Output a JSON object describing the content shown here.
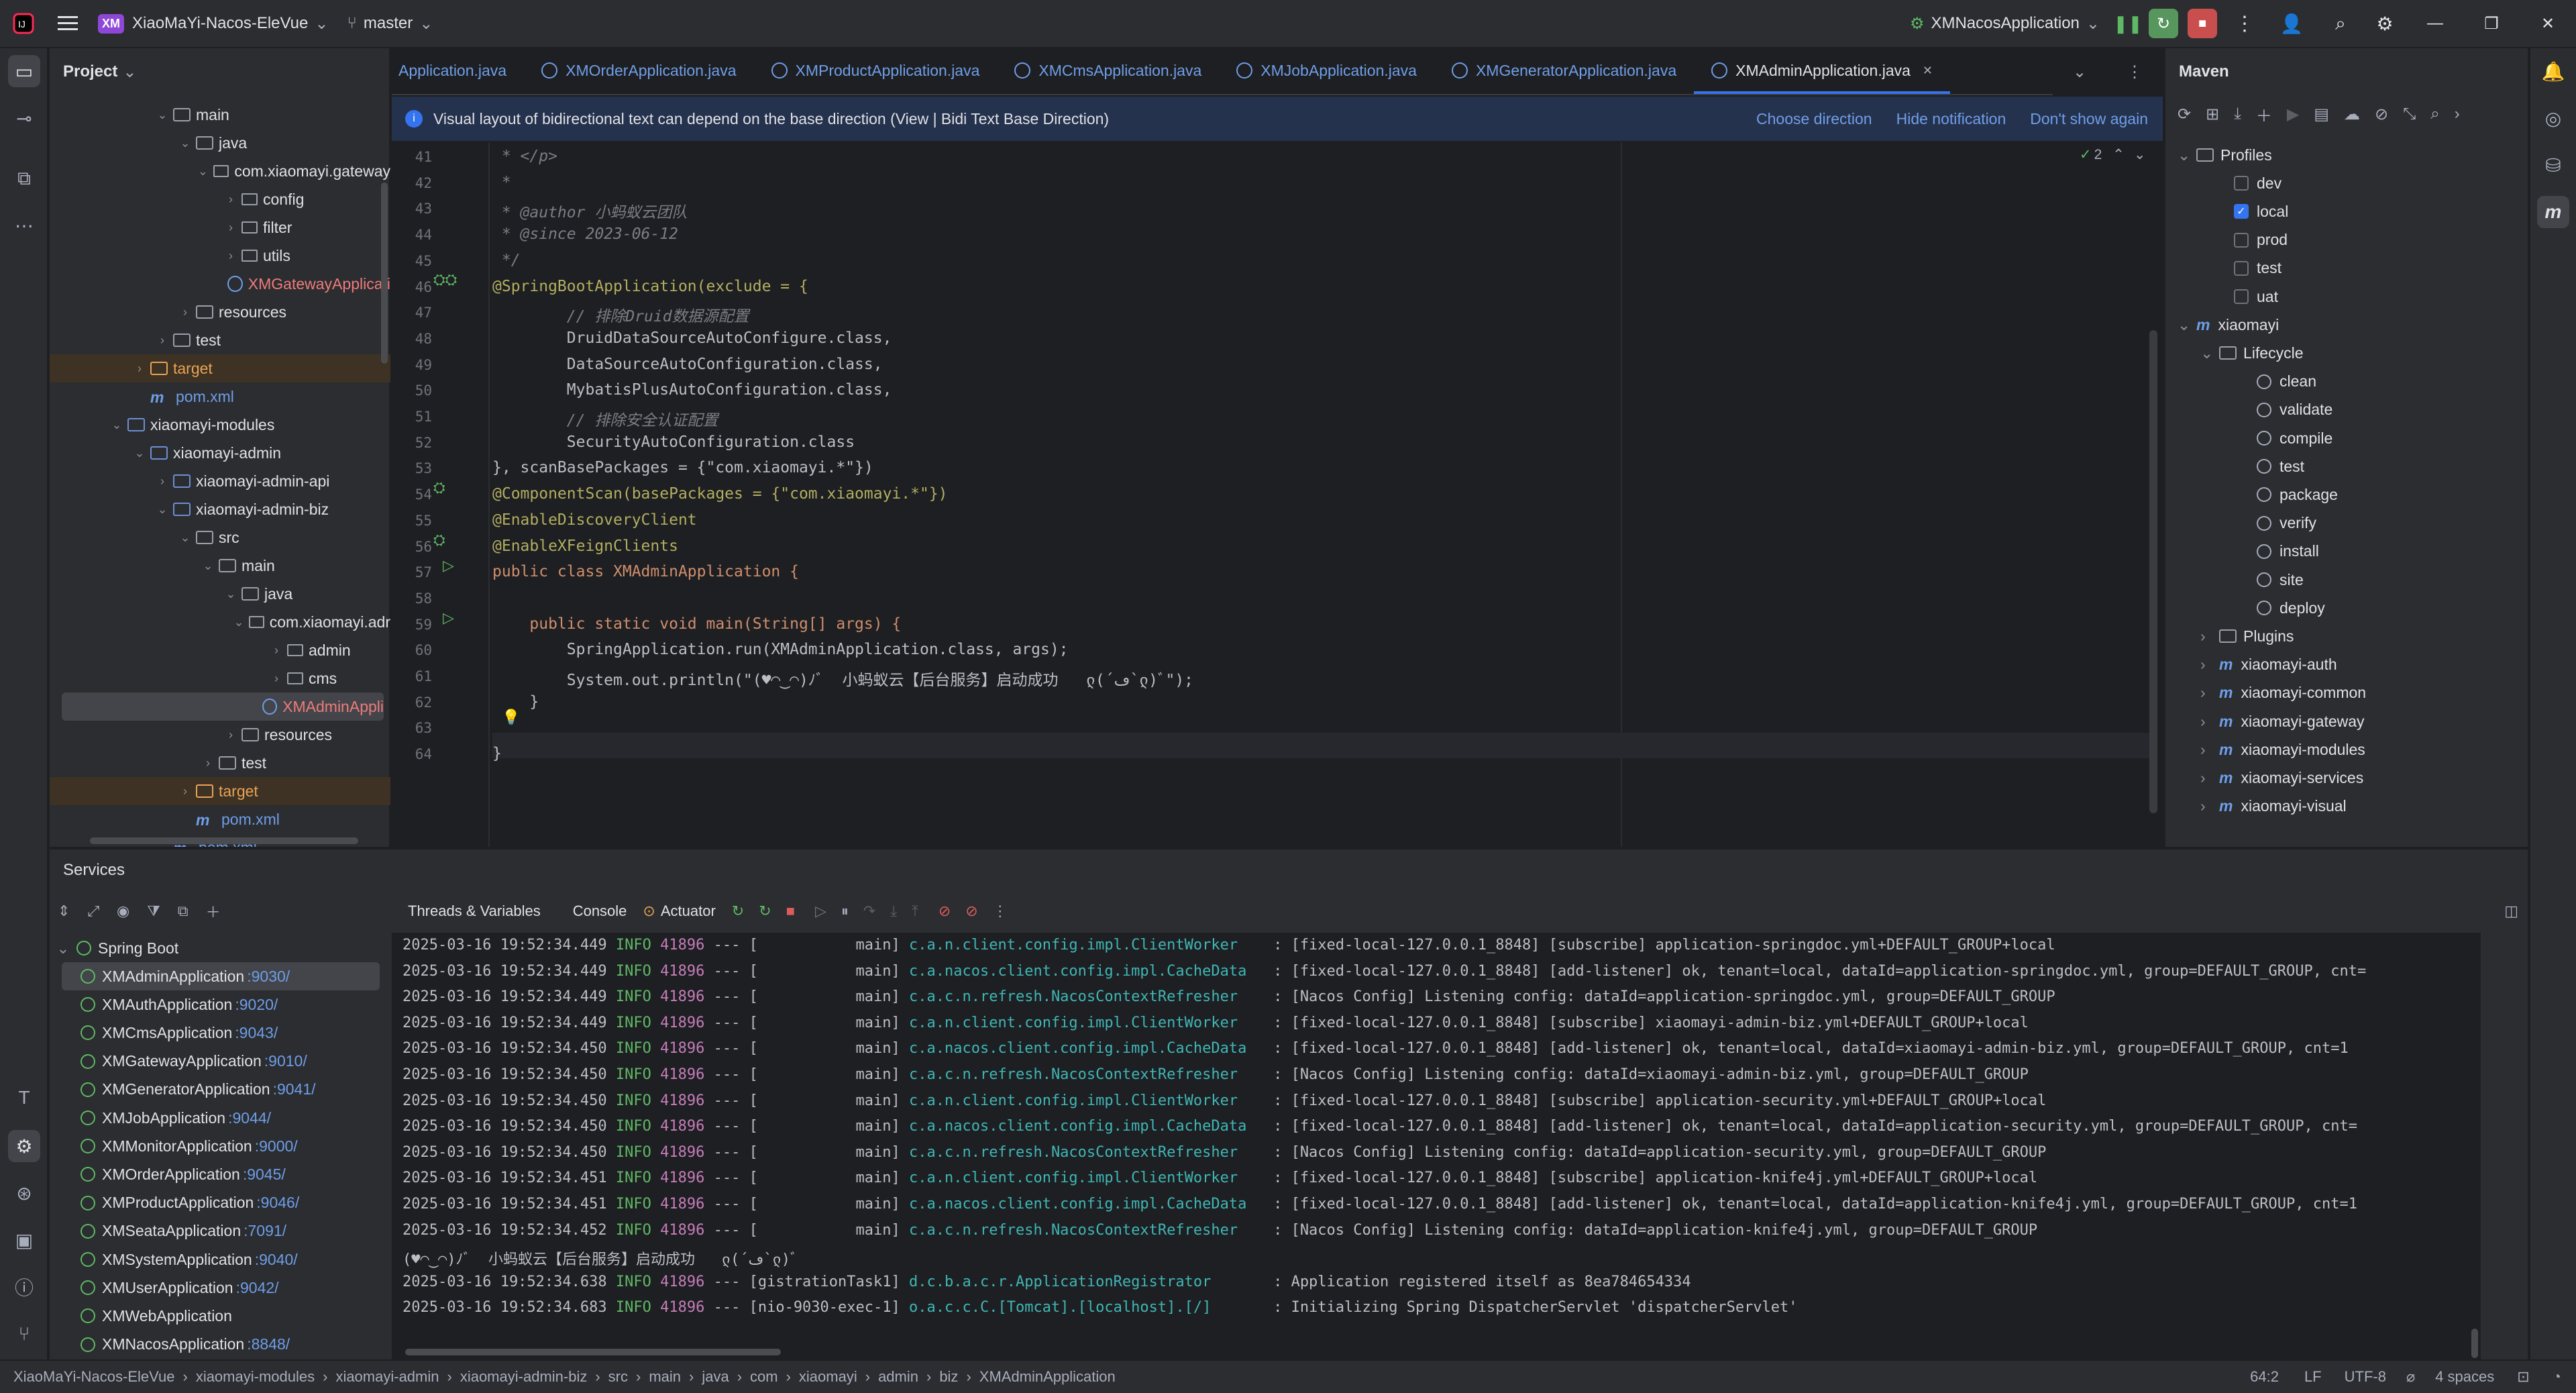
{
  "titlebar": {
    "project_badge": "XM",
    "project": "XiaoMaYi-Nacos-EleVue",
    "branch": "master",
    "run_config": "XMNacosApplication"
  },
  "project_panel": {
    "title": "Project",
    "items": [
      {
        "label": "main",
        "depth": 4,
        "icon": "folder",
        "arrow": "v"
      },
      {
        "label": "java",
        "depth": 5,
        "icon": "folder",
        "arrow": "v"
      },
      {
        "label": "com.xiaomayi.gateway",
        "depth": 6,
        "icon": "package",
        "arrow": "v"
      },
      {
        "label": "config",
        "depth": 7,
        "icon": "package",
        "arrow": ">"
      },
      {
        "label": "filter",
        "depth": 7,
        "icon": "package",
        "arrow": ">"
      },
      {
        "label": "utils",
        "depth": 7,
        "icon": "package",
        "arrow": ">"
      },
      {
        "label": "XMGatewayApplicati",
        "depth": 7,
        "icon": "class",
        "arrow": "",
        "color": "red"
      },
      {
        "label": "resources",
        "depth": 5,
        "icon": "folder",
        "arrow": ">"
      },
      {
        "label": "test",
        "depth": 4,
        "icon": "folder",
        "arrow": ">"
      },
      {
        "label": "target",
        "depth": 3,
        "icon": "folder",
        "arrow": ">",
        "excluded": true
      },
      {
        "label": "pom.xml",
        "depth": 3,
        "icon": "maven",
        "arrow": "",
        "color": "blue"
      },
      {
        "label": "xiaomayi-modules",
        "depth": 2,
        "icon": "module",
        "arrow": "v"
      },
      {
        "label": "xiaomayi-admin",
        "depth": 3,
        "icon": "module",
        "arrow": "v"
      },
      {
        "label": "xiaomayi-admin-api",
        "depth": 4,
        "icon": "module",
        "arrow": ">"
      },
      {
        "label": "xiaomayi-admin-biz",
        "depth": 4,
        "icon": "module",
        "arrow": "v"
      },
      {
        "label": "src",
        "depth": 5,
        "icon": "folder",
        "arrow": "v"
      },
      {
        "label": "main",
        "depth": 6,
        "icon": "folder",
        "arrow": "v"
      },
      {
        "label": "java",
        "depth": 7,
        "icon": "folder",
        "arrow": "v"
      },
      {
        "label": "com.xiaomayi.adr",
        "depth": 8,
        "icon": "package",
        "arrow": "v"
      },
      {
        "label": "admin",
        "depth": 9,
        "icon": "package",
        "arrow": ">"
      },
      {
        "label": "cms",
        "depth": 9,
        "icon": "package",
        "arrow": ">"
      },
      {
        "label": "XMAdminAppli",
        "depth": 9,
        "icon": "class",
        "arrow": "",
        "color": "red",
        "selected": true
      },
      {
        "label": "resources",
        "depth": 7,
        "icon": "folder",
        "arrow": ">"
      },
      {
        "label": "test",
        "depth": 6,
        "icon": "folder",
        "arrow": ">"
      },
      {
        "label": "target",
        "depth": 5,
        "icon": "folder",
        "arrow": ">",
        "excluded": true
      },
      {
        "label": "pom.xml",
        "depth": 5,
        "icon": "maven",
        "arrow": "",
        "color": "blue"
      },
      {
        "label": "pom.xml",
        "depth": 4,
        "icon": "maven",
        "arrow": "",
        "color": "blue"
      }
    ]
  },
  "editor": {
    "tabs": [
      "Application.java",
      "XMOrderApplication.java",
      "XMProductApplication.java",
      "XMCmsApplication.java",
      "XMJobApplication.java",
      "XMGeneratorApplication.java",
      "XMAdminApplication.java"
    ],
    "active_tab": "XMAdminApplication.java",
    "notification": {
      "text": "Visual layout of bidirectional text can depend on the base direction (View | Bidi Text Base Direction)",
      "actions": [
        "Choose direction",
        "Hide notification",
        "Don't show again"
      ]
    },
    "inspection_count": "2",
    "line_numbers": [
      "41",
      "42",
      "43",
      "44",
      "45",
      "46",
      "47",
      "48",
      "49",
      "50",
      "51",
      "52",
      "53",
      "54",
      "55",
      "56",
      "57",
      "58",
      "59",
      "60",
      "61",
      "62",
      "63",
      "64"
    ],
    "code_lines": [
      " * </p>",
      " *",
      " * @author 小蚂蚁云团队",
      " * @since 2023-06-12",
      " */",
      "@SpringBootApplication(exclude = {",
      "        // 排除Druid数据源配置",
      "        DruidDataSourceAutoConfigure.class,",
      "        DataSourceAutoConfiguration.class,",
      "        MybatisPlusAutoConfiguration.class,",
      "        // 排除安全认证配置",
      "        SecurityAutoConfiguration.class",
      "}, scanBasePackages = {\"com.xiaomayi.*\"})",
      "@ComponentScan(basePackages = {\"com.xiaomayi.*\"})",
      "@EnableDiscoveryClient",
      "@EnableXFeignClients",
      "public class XMAdminApplication {",
      "",
      "    public static void main(String[] args) {",
      "        SpringApplication.run(XMAdminApplication.class, args);",
      "        System.out.println(\"(♥◠‿◠)ﾉﾞ  小蚂蚁云【后台服务】启动成功   ლ(´ڡ`ლ)ﾞ\");",
      "    }",
      "",
      "}"
    ]
  },
  "maven": {
    "title": "Maven",
    "items": [
      {
        "label": "Profiles",
        "depth": 0,
        "kind": "folder",
        "arrow": "v"
      },
      {
        "label": "dev",
        "depth": 1,
        "kind": "check",
        "checked": false
      },
      {
        "label": "local",
        "depth": 1,
        "kind": "check",
        "checked": true
      },
      {
        "label": "prod",
        "depth": 1,
        "kind": "check",
        "checked": false
      },
      {
        "label": "test",
        "depth": 1,
        "kind": "check",
        "checked": false
      },
      {
        "label": "uat",
        "depth": 1,
        "kind": "check",
        "checked": false
      },
      {
        "label": "xiaomayi",
        "depth": 0,
        "kind": "maven",
        "arrow": "v"
      },
      {
        "label": "Lifecycle",
        "depth": 1,
        "kind": "folder",
        "arrow": "v"
      },
      {
        "label": "clean",
        "depth": 2,
        "kind": "goal"
      },
      {
        "label": "validate",
        "depth": 2,
        "kind": "goal"
      },
      {
        "label": "compile",
        "depth": 2,
        "kind": "goal"
      },
      {
        "label": "test",
        "depth": 2,
        "kind": "goal"
      },
      {
        "label": "package",
        "depth": 2,
        "kind": "goal"
      },
      {
        "label": "verify",
        "depth": 2,
        "kind": "goal"
      },
      {
        "label": "install",
        "depth": 2,
        "kind": "goal"
      },
      {
        "label": "site",
        "depth": 2,
        "kind": "goal"
      },
      {
        "label": "deploy",
        "depth": 2,
        "kind": "goal"
      },
      {
        "label": "Plugins",
        "depth": 1,
        "kind": "folder",
        "arrow": ">"
      },
      {
        "label": "xiaomayi-auth",
        "depth": 1,
        "kind": "maven",
        "arrow": ">"
      },
      {
        "label": "xiaomayi-common",
        "depth": 1,
        "kind": "maven",
        "arrow": ">"
      },
      {
        "label": "xiaomayi-gateway",
        "depth": 1,
        "kind": "maven",
        "arrow": ">"
      },
      {
        "label": "xiaomayi-modules",
        "depth": 1,
        "kind": "maven",
        "arrow": ">"
      },
      {
        "label": "xiaomayi-services",
        "depth": 1,
        "kind": "maven",
        "arrow": ">"
      },
      {
        "label": "xiaomayi-visual",
        "depth": 1,
        "kind": "maven",
        "arrow": ">"
      }
    ]
  },
  "services": {
    "title": "Services",
    "console_tabs": [
      "Threads & Variables",
      "Console",
      "Actuator"
    ],
    "group": "Spring Boot",
    "apps": [
      {
        "name": "XMAdminApplication",
        "port": ":9030/",
        "selected": true
      },
      {
        "name": "XMAuthApplication",
        "port": ":9020/"
      },
      {
        "name": "XMCmsApplication",
        "port": ":9043/"
      },
      {
        "name": "XMGatewayApplication",
        "port": ":9010/"
      },
      {
        "name": "XMGeneratorApplication",
        "port": ":9041/"
      },
      {
        "name": "XMJobApplication",
        "port": ":9044/"
      },
      {
        "name": "XMMonitorApplication",
        "port": ":9000/"
      },
      {
        "name": "XMOrderApplication",
        "port": ":9045/"
      },
      {
        "name": "XMProductApplication",
        "port": ":9046/"
      },
      {
        "name": "XMSeataApplication",
        "port": ":7091/"
      },
      {
        "name": "XMSystemApplication",
        "port": ":9040/"
      },
      {
        "name": "XMUserApplication",
        "port": ":9042/"
      },
      {
        "name": "XMWebApplication",
        "port": ""
      },
      {
        "name": "XMNacosApplication",
        "port": ":8848/"
      }
    ]
  },
  "console": {
    "lines": [
      {
        "ts": "2025-03-16 19:52:34.449",
        "lvl": "INFO",
        "pid": "41896",
        "th": "--- [           main]",
        "cls": "c.a.n.client.config.impl.ClientWorker   ",
        "msg": ": [fixed-local-127.0.0.1_8848] [subscribe] application-springdoc.yml+DEFAULT_GROUP+local"
      },
      {
        "ts": "2025-03-16 19:52:34.449",
        "lvl": "INFO",
        "pid": "41896",
        "th": "--- [           main]",
        "cls": "c.a.nacos.client.config.impl.CacheData  ",
        "msg": ": [fixed-local-127.0.0.1_8848] [add-listener] ok, tenant=local, dataId=application-springdoc.yml, group=DEFAULT_GROUP, cnt="
      },
      {
        "ts": "2025-03-16 19:52:34.449",
        "lvl": "INFO",
        "pid": "41896",
        "th": "--- [           main]",
        "cls": "c.a.c.n.refresh.NacosContextRefresher   ",
        "msg": ": [Nacos Config] Listening config: dataId=application-springdoc.yml, group=DEFAULT_GROUP"
      },
      {
        "ts": "2025-03-16 19:52:34.449",
        "lvl": "INFO",
        "pid": "41896",
        "th": "--- [           main]",
        "cls": "c.a.n.client.config.impl.ClientWorker   ",
        "msg": ": [fixed-local-127.0.0.1_8848] [subscribe] xiaomayi-admin-biz.yml+DEFAULT_GROUP+local"
      },
      {
        "ts": "2025-03-16 19:52:34.450",
        "lvl": "INFO",
        "pid": "41896",
        "th": "--- [           main]",
        "cls": "c.a.nacos.client.config.impl.CacheData  ",
        "msg": ": [fixed-local-127.0.0.1_8848] [add-listener] ok, tenant=local, dataId=xiaomayi-admin-biz.yml, group=DEFAULT_GROUP, cnt=1"
      },
      {
        "ts": "2025-03-16 19:52:34.450",
        "lvl": "INFO",
        "pid": "41896",
        "th": "--- [           main]",
        "cls": "c.a.c.n.refresh.NacosContextRefresher   ",
        "msg": ": [Nacos Config] Listening config: dataId=xiaomayi-admin-biz.yml, group=DEFAULT_GROUP"
      },
      {
        "ts": "2025-03-16 19:52:34.450",
        "lvl": "INFO",
        "pid": "41896",
        "th": "--- [           main]",
        "cls": "c.a.n.client.config.impl.ClientWorker   ",
        "msg": ": [fixed-local-127.0.0.1_8848] [subscribe] application-security.yml+DEFAULT_GROUP+local"
      },
      {
        "ts": "2025-03-16 19:52:34.450",
        "lvl": "INFO",
        "pid": "41896",
        "th": "--- [           main]",
        "cls": "c.a.nacos.client.config.impl.CacheData  ",
        "msg": ": [fixed-local-127.0.0.1_8848] [add-listener] ok, tenant=local, dataId=application-security.yml, group=DEFAULT_GROUP, cnt="
      },
      {
        "ts": "2025-03-16 19:52:34.450",
        "lvl": "INFO",
        "pid": "41896",
        "th": "--- [           main]",
        "cls": "c.a.c.n.refresh.NacosContextRefresher   ",
        "msg": ": [Nacos Config] Listening config: dataId=application-security.yml, group=DEFAULT_GROUP"
      },
      {
        "ts": "2025-03-16 19:52:34.451",
        "lvl": "INFO",
        "pid": "41896",
        "th": "--- [           main]",
        "cls": "c.a.n.client.config.impl.ClientWorker   ",
        "msg": ": [fixed-local-127.0.0.1_8848] [subscribe] application-knife4j.yml+DEFAULT_GROUP+local"
      },
      {
        "ts": "2025-03-16 19:52:34.451",
        "lvl": "INFO",
        "pid": "41896",
        "th": "--- [           main]",
        "cls": "c.a.nacos.client.config.impl.CacheData  ",
        "msg": ": [fixed-local-127.0.0.1_8848] [add-listener] ok, tenant=local, dataId=application-knife4j.yml, group=DEFAULT_GROUP, cnt=1"
      },
      {
        "ts": "2025-03-16 19:52:34.452",
        "lvl": "INFO",
        "pid": "41896",
        "th": "--- [           main]",
        "cls": "c.a.c.n.refresh.NacosContextRefresher   ",
        "msg": ": [Nacos Config] Listening config: dataId=application-knife4j.yml, group=DEFAULT_GROUP"
      },
      {
        "raw": "(♥◠‿◠)ﾉﾞ  小蚂蚁云【后台服务】启动成功   ლ(´ڡ`ლ)ﾞ"
      },
      {
        "ts": "2025-03-16 19:52:34.638",
        "lvl": "INFO",
        "pid": "41896",
        "th": "--- [gistrationTask1]",
        "cls": "d.c.b.a.c.r.ApplicationRegistrator      ",
        "msg": ": Application registered itself as 8ea784654334"
      },
      {
        "ts": "2025-03-16 19:52:34.683",
        "lvl": "INFO",
        "pid": "41896",
        "th": "--- [nio-9030-exec-1]",
        "cls": "o.a.c.c.C.[Tomcat].[localhost].[/]      ",
        "msg": ": Initializing Spring DispatcherServlet 'dispatcherServlet'"
      }
    ]
  },
  "statusbar": {
    "breadcrumbs": [
      "XiaoMaYi-Nacos-EleVue",
      "xiaomayi-modules",
      "xiaomayi-admin",
      "xiaomayi-admin-biz",
      "src",
      "main",
      "java",
      "com",
      "xiaomayi",
      "admin",
      "biz",
      "XMAdminApplication"
    ],
    "position": "64:2",
    "line_sep": "LF",
    "encoding": "UTF-8",
    "indent": "4 spaces"
  },
  "colors": {
    "accent": "#3574f0",
    "bg": "#1e1f22",
    "panel": "#2b2d30"
  }
}
